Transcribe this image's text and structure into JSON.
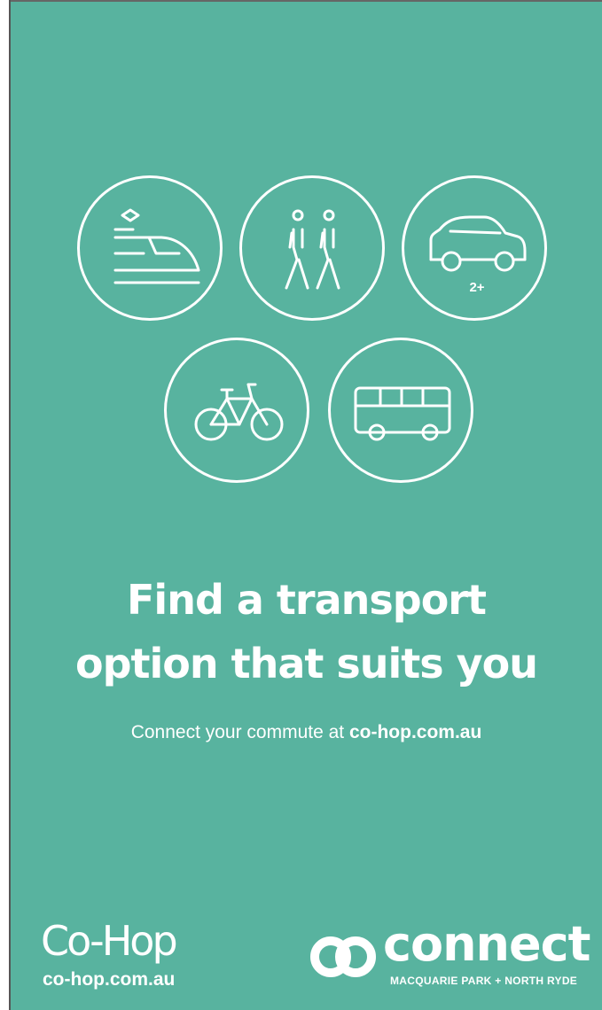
{
  "poster": {
    "background_color": "#58b39f",
    "foreground_color": "#ffffff",
    "icons": [
      {
        "name": "train-icon"
      },
      {
        "name": "walking-icon"
      },
      {
        "name": "carpool-icon",
        "caption": "2+"
      },
      {
        "name": "bicycle-icon"
      },
      {
        "name": "bus-icon"
      }
    ],
    "headline_line1": "Find a transport",
    "headline_line2": "option that suits you",
    "subline_prefix": "Connect your commute at ",
    "subline_link": "co-hop.com.au"
  },
  "footer": {
    "cohop_logo_text": "Co-Hop",
    "cohop_url": "co-hop.com.au",
    "connect_logo_text": "connect",
    "connect_subtitle": "MACQUARIE PARK + NORTH RYDE"
  }
}
